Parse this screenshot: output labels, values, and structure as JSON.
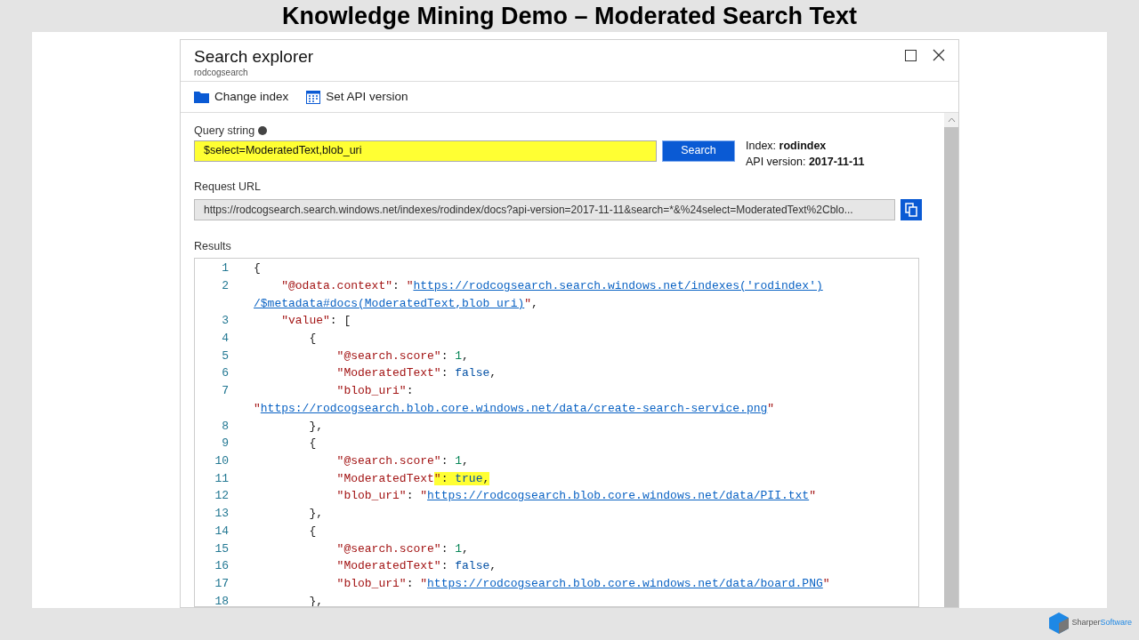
{
  "slide_title": "Knowledge Mining Demo – Moderated Search Text",
  "blade": {
    "title": "Search explorer",
    "subtitle": "rodcogsearch"
  },
  "toolbar": [
    {
      "kind": "folder",
      "label": "Change index"
    },
    {
      "kind": "calendar",
      "label": "Set API version"
    }
  ],
  "query": {
    "label": "Query string",
    "value": "$select=ModeratedText,blob_uri",
    "highlighted": true,
    "button": "Search"
  },
  "info": [
    {
      "label": "Index: ",
      "value": "rodindex"
    },
    {
      "label": "API version: ",
      "value": "2017-11-11"
    }
  ],
  "request_url": {
    "label": "Request URL",
    "value": "https://rodcogsearch.search.windows.net/indexes/rodindex/docs?api-version=2017-11-11&search=*&%24select=ModeratedText%2Cblo..."
  },
  "results": {
    "label": "Results",
    "lines": [
      {
        "number": "1",
        "tokens": [
          {
            "kind": "punct",
            "text": "{"
          }
        ]
      },
      {
        "number": "2",
        "tokens": [
          {
            "kind": "key",
            "text": "    \"@odata.context\""
          },
          {
            "kind": "punct",
            "text": ": "
          },
          {
            "kind": "string",
            "text": "\""
          },
          {
            "kind": "link",
            "text": "https://rodcogsearch.search.windows.net/indexes('rodindex')"
          }
        ]
      },
      {
        "tokens": [
          {
            "kind": "link",
            "text": "/$metadata#docs(ModeratedText,blob_uri)"
          },
          {
            "kind": "string",
            "text": "\""
          },
          {
            "kind": "punct",
            "text": ","
          }
        ]
      },
      {
        "number": "3",
        "tokens": [
          {
            "kind": "key",
            "text": "    \"value\""
          },
          {
            "kind": "punct",
            "text": ": ["
          }
        ]
      },
      {
        "number": "4",
        "tokens": [
          {
            "kind": "punct",
            "text": "        {"
          }
        ]
      },
      {
        "number": "5",
        "tokens": [
          {
            "kind": "key",
            "text": "            \"@search.score\""
          },
          {
            "kind": "punct",
            "text": ": "
          },
          {
            "kind": "number",
            "text": "1"
          },
          {
            "kind": "punct",
            "text": ","
          }
        ]
      },
      {
        "number": "6",
        "tokens": [
          {
            "kind": "key",
            "text": "            \"ModeratedText\""
          },
          {
            "kind": "punct",
            "text": ": "
          },
          {
            "kind": "bool",
            "text": "false"
          },
          {
            "kind": "punct",
            "text": ","
          }
        ]
      },
      {
        "number": "7",
        "tokens": [
          {
            "kind": "key",
            "text": "            \"blob_uri\""
          },
          {
            "kind": "punct",
            "text": ":"
          }
        ]
      },
      {
        "tokens": [
          {
            "kind": "string",
            "text": "\""
          },
          {
            "kind": "link",
            "text": "https://rodcogsearch.blob.core.windows.net/data/create-search-service.png"
          },
          {
            "kind": "string",
            "text": "\""
          }
        ]
      },
      {
        "number": "8",
        "tokens": [
          {
            "kind": "punct",
            "text": "        },"
          }
        ]
      },
      {
        "number": "9",
        "tokens": [
          {
            "kind": "punct",
            "text": "        {"
          }
        ]
      },
      {
        "number": "10",
        "tokens": [
          {
            "kind": "key",
            "text": "            \"@search.score\""
          },
          {
            "kind": "punct",
            "text": ": "
          },
          {
            "kind": "number",
            "text": "1"
          },
          {
            "kind": "punct",
            "text": ","
          }
        ]
      },
      {
        "number": "11",
        "tokens": [
          {
            "kind": "key",
            "text": "            \"ModeratedText"
          },
          {
            "kind": "key",
            "text": "\"",
            "highlighted": true
          },
          {
            "kind": "punct",
            "text": ": ",
            "highlighted": true
          },
          {
            "kind": "bool",
            "text": "true",
            "highlighted": true
          },
          {
            "kind": "punct",
            "text": ",",
            "highlighted": true
          }
        ]
      },
      {
        "number": "12",
        "tokens": [
          {
            "kind": "key",
            "text": "            \"blob_uri\""
          },
          {
            "kind": "punct",
            "text": ": "
          },
          {
            "kind": "string",
            "text": "\""
          },
          {
            "kind": "link",
            "text": "https://rodcogsearch.blob.core.windows.net/data/PII.txt"
          },
          {
            "kind": "string",
            "text": "\""
          }
        ]
      },
      {
        "number": "13",
        "tokens": [
          {
            "kind": "punct",
            "text": "        },"
          }
        ]
      },
      {
        "number": "14",
        "tokens": [
          {
            "kind": "punct",
            "text": "        {"
          }
        ]
      },
      {
        "number": "15",
        "tokens": [
          {
            "kind": "key",
            "text": "            \"@search.score\""
          },
          {
            "kind": "punct",
            "text": ": "
          },
          {
            "kind": "number",
            "text": "1"
          },
          {
            "kind": "punct",
            "text": ","
          }
        ]
      },
      {
        "number": "16",
        "tokens": [
          {
            "kind": "key",
            "text": "            \"ModeratedText\""
          },
          {
            "kind": "punct",
            "text": ": "
          },
          {
            "kind": "bool",
            "text": "false"
          },
          {
            "kind": "punct",
            "text": ","
          }
        ]
      },
      {
        "number": "17",
        "tokens": [
          {
            "kind": "key",
            "text": "            \"blob_uri\""
          },
          {
            "kind": "punct",
            "text": ": "
          },
          {
            "kind": "string",
            "text": "\""
          },
          {
            "kind": "link",
            "text": "https://rodcogsearch.blob.core.windows.net/data/board.PNG"
          },
          {
            "kind": "string",
            "text": "\""
          }
        ]
      },
      {
        "number": "18",
        "tokens": [
          {
            "kind": "punct",
            "text": "        },"
          }
        ]
      }
    ]
  },
  "brand": {
    "part_1": "Sharper",
    "part_2": "Software"
  }
}
